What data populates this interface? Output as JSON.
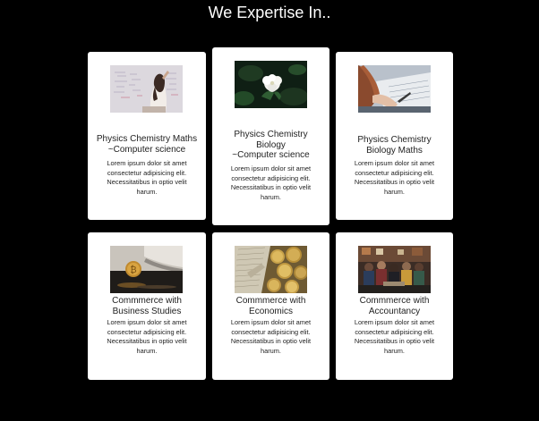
{
  "heading": "We Expertise In..",
  "cards": [
    {
      "title_lines": [
        "Physics Chemistry Maths",
        "~Computer science"
      ],
      "desc_lines": [
        "Lorem ipsum dolor sit amet",
        "consectetur adipisicing elit.",
        "Necessitatibus in optio velit",
        "harum."
      ],
      "image": "girl-at-whiteboard"
    },
    {
      "title_lines": [
        "Physics Chemistry",
        "Biology",
        "~Computer science"
      ],
      "desc_lines": [
        "Lorem ipsum dolor sit amet",
        "consectetur adipisicing elit.",
        "Necessitatibus in optio velit",
        "harum."
      ],
      "image": "white-flower"
    },
    {
      "title_lines": [
        "Physics Chemistry",
        "Biology Maths"
      ],
      "desc_lines": [
        "Lorem ipsum dolor sit amet",
        "consectetur adipisicing elit.",
        "Necessitatibus in optio velit",
        "harum."
      ],
      "image": "student-writing"
    },
    {
      "title_lines": [
        "Commmerce with",
        "Business Studies"
      ],
      "desc_lines": [
        "Lorem ipsum dolor sit amet",
        "consectetur adipisicing elit.",
        "Necessitatibus in optio velit",
        "harum."
      ],
      "image": "bitcoin-coin"
    },
    {
      "title_lines": [
        "Commmerce with",
        "Economics"
      ],
      "desc_lines": [
        "Lorem ipsum dolor sit amet",
        "consectetur adipisicing elit.",
        "Necessitatibus in optio velit",
        "harum."
      ],
      "image": "coins-and-banknotes"
    },
    {
      "title_lines": [
        "Commmerce with",
        "Accountancy"
      ],
      "desc_lines": [
        "Lorem ipsum dolor sit amet",
        "consectetur adipisicing elit.",
        "Necessitatibus in optio velit",
        "harum."
      ],
      "image": "group-of-people"
    }
  ]
}
